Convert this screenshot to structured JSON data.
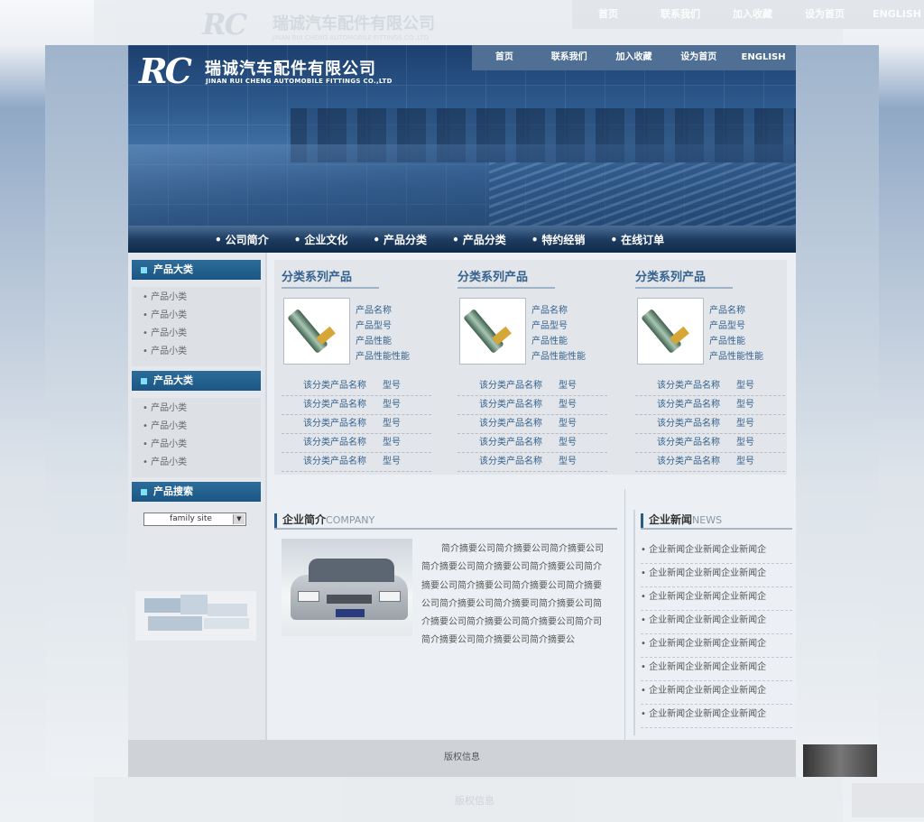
{
  "header": {
    "logo": "RC",
    "company_name": "瑞诚汽车配件有限公司",
    "company_sub": "JINAN RUI CHENG AUTOMOBILE FITTINGS CO.,LTD"
  },
  "top_nav": [
    "首页",
    "联系我们",
    "加入收藏",
    "设为首页",
    "ENGLISH"
  ],
  "main_nav": [
    "公司简介",
    "企业文化",
    "产品分类",
    "产品分类",
    "特约经销",
    "在线订单"
  ],
  "sidebar": {
    "categories": [
      {
        "title": "产品大类",
        "items": [
          "产品小类",
          "产品小类",
          "产品小类",
          "产品小类"
        ]
      },
      {
        "title": "产品大类",
        "items": [
          "产品小类",
          "产品小类",
          "产品小类",
          "产品小类"
        ]
      }
    ],
    "search_title": "产品搜索",
    "search_select": "family site"
  },
  "products": [
    {
      "title": "分类系列产品",
      "meta": [
        "产品名称",
        "产品型号",
        "产品性能",
        "产品性能性能"
      ],
      "rows": [
        {
          "name": "该分类产品名称",
          "model": "型号"
        },
        {
          "name": "该分类产品名称",
          "model": "型号"
        },
        {
          "name": "该分类产品名称",
          "model": "型号"
        },
        {
          "name": "该分类产品名称",
          "model": "型号"
        },
        {
          "name": "该分类产品名称",
          "model": "型号"
        }
      ]
    },
    {
      "title": "分类系列产品",
      "meta": [
        "产品名称",
        "产品型号",
        "产品性能",
        "产品性能性能"
      ],
      "rows": [
        {
          "name": "该分类产品名称",
          "model": "型号"
        },
        {
          "name": "该分类产品名称",
          "model": "型号"
        },
        {
          "name": "该分类产品名称",
          "model": "型号"
        },
        {
          "name": "该分类产品名称",
          "model": "型号"
        },
        {
          "name": "该分类产品名称",
          "model": "型号"
        }
      ]
    },
    {
      "title": "分类系列产品",
      "meta": [
        "产品名称",
        "产品型号",
        "产品性能",
        "产品性能性能"
      ],
      "rows": [
        {
          "name": "该分类产品名称",
          "model": "型号"
        },
        {
          "name": "该分类产品名称",
          "model": "型号"
        },
        {
          "name": "该分类产品名称",
          "model": "型号"
        },
        {
          "name": "该分类产品名称",
          "model": "型号"
        },
        {
          "name": "该分类产品名称",
          "model": "型号"
        }
      ]
    }
  ],
  "company": {
    "title": "企业简介",
    "title_en": "COMPANY",
    "text": "简介摘要公司简介摘要公司简介摘要公司简介摘要公司简介摘要公司简介摘要公司简介摘要公司简介摘要公司简介摘要公司简介摘要公司简介摘要公司简介摘要司简介摘要公司简介摘要公司简介摘要公司简介摘要公司简介司简介摘要公司简介摘要公司简介摘要公"
  },
  "news": {
    "title": "企业新闻",
    "title_en": "NEWS",
    "items": [
      "企业新闻企业新闻企业新闻企",
      "企业新闻企业新闻企业新闻企",
      "企业新闻企业新闻企业新闻企",
      "企业新闻企业新闻企业新闻企",
      "企业新闻企业新闻企业新闻企",
      "企业新闻企业新闻企业新闻企",
      "企业新闻企业新闻企业新闻企",
      "企业新闻企业新闻企业新闻企"
    ]
  },
  "footer": {
    "copyright": "版权信息"
  },
  "colors": {
    "nav_dark": "#1e3d62",
    "link_blue": "#35628e",
    "accent_cyan": "#7ee0f5"
  }
}
